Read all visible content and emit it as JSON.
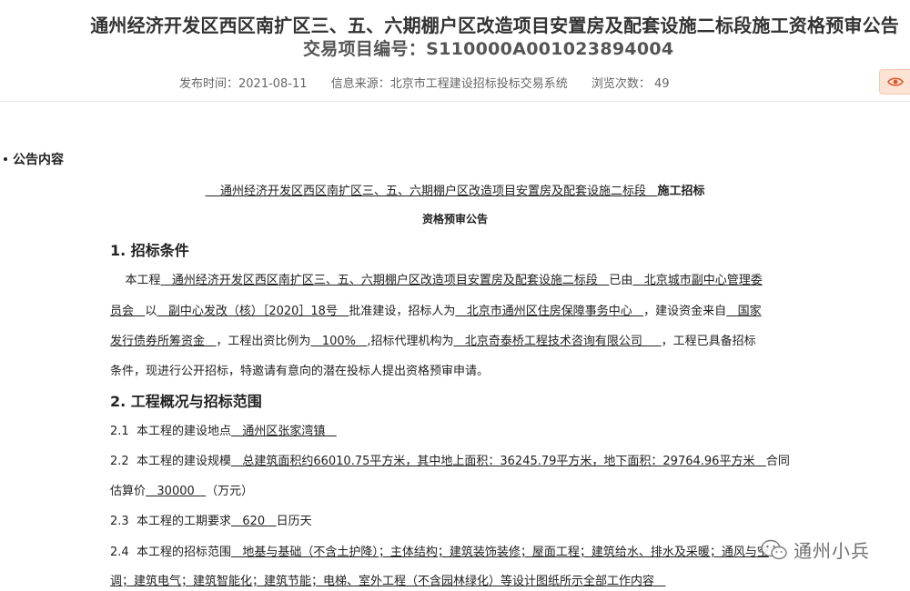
{
  "header": {
    "title": "通州经济开发区西区南扩区三、五、六期棚户区改造项目安置房及配套设施二标段施工资格预审公告",
    "project_code": "交易项目编号：S110000A001023894004",
    "publish_time": "发布时间：2021-08-11",
    "source": "信息来源：北京市工程建设招标投标交易系统",
    "views": "浏览次数： 49"
  },
  "section": {
    "heading": "公告内容"
  },
  "doc": {
    "title_line1_pre": "    通州经济开发区西区南扩区三、五、六期棚户区改造项目安置房及配套设施二标段   ",
    "title_line1_bold": "施工招标",
    "title_line2": "资格预审公告",
    "s1_heading": "1. 招标条件",
    "s1_p1_a": "    本工程",
    "s1_p1_b": "   通州经济开发区西区南扩区三、五、六期棚户区改造项目安置房及配套设施二标段   ",
    "s1_p1_c": "已由",
    "s1_p1_d": "   北京城市副中心管理委",
    "s1_p2_a": "员会   ",
    "s1_p2_b": "以",
    "s1_p2_c": "   副中心发改（核）［2020］18号   ",
    "s1_p2_d": "批准建设，招标人为",
    "s1_p2_e": "   北京市通州区住房保障事务中心   ",
    "s1_p2_f": "，建设资金来自",
    "s1_p2_g": "   国家",
    "s1_p3_a": "发行债券所筹资金   ",
    "s1_p3_b": "，工程出资比例为",
    "s1_p3_c": "   100%   ",
    "s1_p3_d": ",招标代理机构为",
    "s1_p3_e": "   北京奇泰桥工程技术咨询有限公司     ",
    "s1_p3_f": "，工程已具备招标",
    "s1_p4": "条件，现进行公开招标，特邀请有意向的潜在投标人提出资格预审申请。",
    "s2_heading": "2. 工程概况与招标范围",
    "s2_1_a": "2.1  本工程的建设地点",
    "s2_1_b": "   通州区张家湾镇   ",
    "s2_2_a": "2.2  本工程的建设规模",
    "s2_2_b": "   总建筑面积约66010.75平方米，其中地上面积：36245.79平方米，地下面积：29764.96平方米   ",
    "s2_2_c": "合同",
    "s2_2_d": "估算价",
    "s2_2_e": "   30000   ",
    "s2_2_f": "（万元）",
    "s2_3_a": "2.3  本工程的工期要求",
    "s2_3_b": "   620   ",
    "s2_3_c": "日历天",
    "s2_4_a": "2.4  本工程的招标范围",
    "s2_4_b": "   地基与基础（不含土护降）；主体结构；建筑装饰装修；屋面工程；建筑给水、排水及采暖；通风与空",
    "s2_4_c": "调；建筑电气；建筑智能化；建筑节能；电梯、室外工程（不含园林绿化）等设计图纸所示全部工作内容   "
  },
  "watermark": {
    "text": "通州小兵",
    "icon": "wechat-icon"
  },
  "icons": {
    "eye": "eye-icon"
  },
  "colors": {
    "eye_button_bg": "#fde3d4",
    "eye_icon": "#e0552a"
  }
}
